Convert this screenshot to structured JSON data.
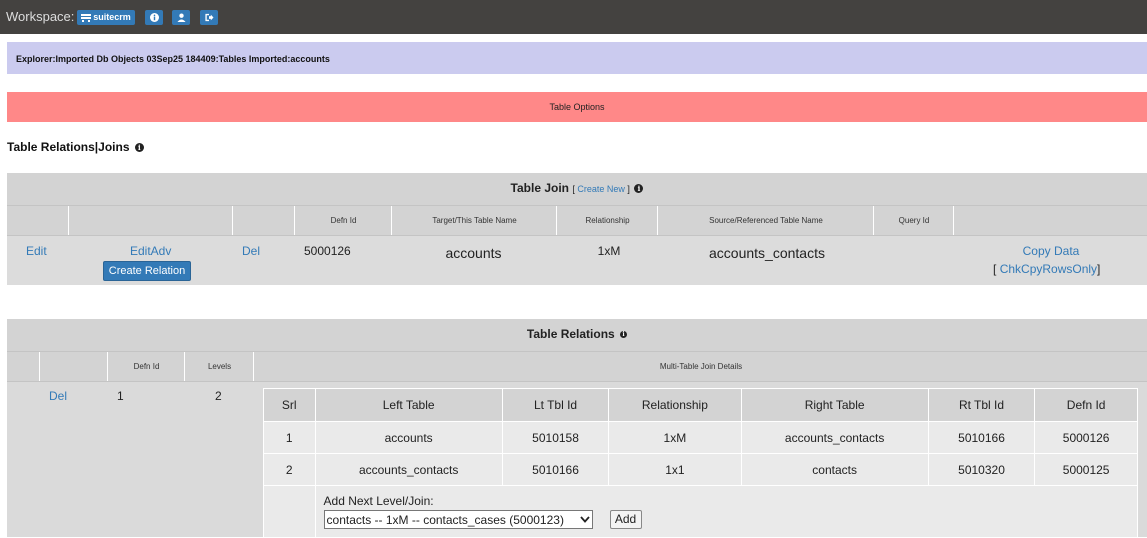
{
  "topbar": {
    "workspace_label": "Workspace:",
    "app_button": "suitecrm",
    "icons": [
      "info-icon",
      "user-icon",
      "logout-icon"
    ]
  },
  "breadcrumb": "Explorer:Imported Db Objects 03Sep25 184409:Tables Imported:accounts",
  "table_options": "Table Options",
  "section_title": "Table Relations|Joins",
  "join_panel": {
    "title": "Table Join",
    "create_new": "Create New",
    "bracket_open": "[",
    "bracket_close": "]",
    "headers": [
      "Defn Id",
      "Target/This Table Name",
      "Relationship",
      "Source/Referenced Table Name",
      "Query Id"
    ],
    "row": {
      "edit": "Edit",
      "edit_adv": "EditAdv",
      "create_relation": "Create Relation",
      "del": "Del",
      "defn_id": "5000126",
      "target": "accounts",
      "relationship": "1xM",
      "source": "accounts_contacts",
      "query_id": "",
      "copy_data": "Copy Data",
      "chk_copy": "ChkCpyRowsOnly"
    }
  },
  "relations_panel": {
    "title": "Table Relations",
    "headers": [
      "Defn Id",
      "Levels",
      "Multi-Table Join Details"
    ],
    "row": {
      "del": "Del",
      "defn_id": "1",
      "levels": "2"
    },
    "nested": {
      "columns": [
        "Srl",
        "Left Table",
        "Lt Tbl Id",
        "Relationship",
        "Right Table",
        "Rt Tbl Id",
        "Defn Id"
      ],
      "rows": [
        [
          "1",
          "accounts",
          "5010158",
          "1xM",
          "accounts_contacts",
          "5010166",
          "5000126"
        ],
        [
          "2",
          "accounts_contacts",
          "5010166",
          "1x1",
          "contacts",
          "5010320",
          "5000125"
        ]
      ],
      "add_label": "Add Next Level/Join:",
      "select_value": "contacts -- 1xM -- contacts_cases (5000123)",
      "add_button": "Add"
    }
  },
  "colors": {
    "topbar": "#444240",
    "breadcrumb": "#cbcbef",
    "options": "#ff8888",
    "accent": "#337ab7"
  }
}
